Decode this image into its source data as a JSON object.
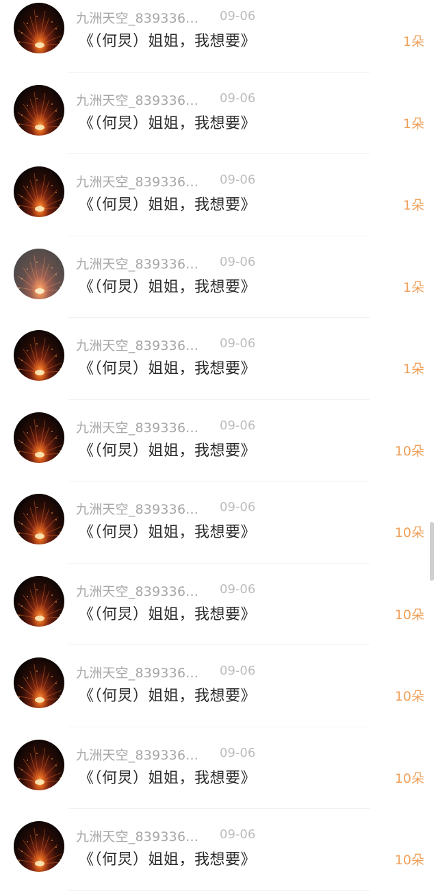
{
  "records": [
    {
      "user": "九洲天空_839336...",
      "date": "09-06",
      "gift": "《（何炅）姐姐，我想要》",
      "count": "1朵",
      "dim": false
    },
    {
      "user": "九洲天空_839336...",
      "date": "09-06",
      "gift": "《（何炅）姐姐，我想要》",
      "count": "1朵",
      "dim": false
    },
    {
      "user": "九洲天空_839336...",
      "date": "09-06",
      "gift": "《（何炅）姐姐，我想要》",
      "count": "1朵",
      "dim": false
    },
    {
      "user": "九洲天空_839336...",
      "date": "09-06",
      "gift": "《（何炅）姐姐，我想要》",
      "count": "1朵",
      "dim": true
    },
    {
      "user": "九洲天空_839336...",
      "date": "09-06",
      "gift": "《（何炅）姐姐，我想要》",
      "count": "1朵",
      "dim": false
    },
    {
      "user": "九洲天空_839336...",
      "date": "09-06",
      "gift": "《（何炅）姐姐，我想要》",
      "count": "10朵",
      "dim": false
    },
    {
      "user": "九洲天空_839336...",
      "date": "09-06",
      "gift": "《（何炅）姐姐，我想要》",
      "count": "10朵",
      "dim": false
    },
    {
      "user": "九洲天空_839336...",
      "date": "09-06",
      "gift": "《（何炅）姐姐，我想要》",
      "count": "10朵",
      "dim": false
    },
    {
      "user": "九洲天空_839336...",
      "date": "09-06",
      "gift": "《（何炅）姐姐，我想要》",
      "count": "10朵",
      "dim": false
    },
    {
      "user": "九洲天空_839336...",
      "date": "09-06",
      "gift": "《（何炅）姐姐，我想要》",
      "count": "10朵",
      "dim": false
    },
    {
      "user": "九洲天空_839336...",
      "date": "09-06",
      "gift": "《（何炅）姐姐，我想要》",
      "count": "10朵",
      "dim": false
    }
  ],
  "colors": {
    "username": "#a6a6a6",
    "date": "#bdbdbd",
    "gift_text": "#2b2b2b",
    "count": "#f0a05a",
    "divider": "#f1f1f1"
  },
  "icons": {
    "avatar": "fireworks-avatar-image"
  }
}
